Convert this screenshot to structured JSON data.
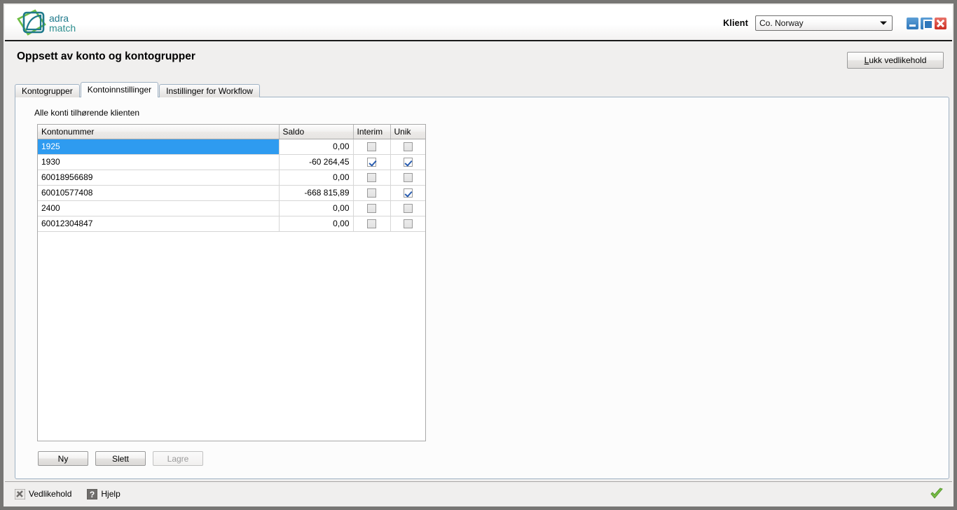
{
  "brand": {
    "logo_name": "adra-match-logo",
    "logo_line1": "adra",
    "logo_line2": "match",
    "teal": "#1f7a8c",
    "green": "#6fbe44"
  },
  "titlebar": {
    "client_label": "Klient",
    "client_value": "Co. Norway",
    "client_options": [
      "Co. Norway"
    ],
    "window_buttons": {
      "minimize": "minimize-icon",
      "maximize": "maximize-icon",
      "close": "close-icon"
    }
  },
  "header": {
    "title": "Oppsett av konto og kontogrupper",
    "close_button_accel": "L",
    "close_button_rest": "ukk vedlikehold",
    "close_button_label": "Lukk vedlikehold"
  },
  "tabs": [
    {
      "label": "Kontogrupper",
      "active": false
    },
    {
      "label": "Kontoinnstillinger",
      "active": true
    },
    {
      "label": "Instillinger for Workflow",
      "active": false
    }
  ],
  "panel": {
    "label": "Alle konti tilhørende klienten"
  },
  "grid": {
    "columns": [
      "Kontonummer",
      "Saldo",
      "Interim",
      "Unik"
    ],
    "selected_row_index": 0,
    "selected_row_color": "#2e9bf0",
    "rows": [
      {
        "kontonummer": "1925",
        "saldo": "0,00",
        "interim": false,
        "unik": false
      },
      {
        "kontonummer": "1930",
        "saldo": "-60 264,45",
        "interim": true,
        "unik": true
      },
      {
        "kontonummer": "60018956689",
        "saldo": "0,00",
        "interim": false,
        "unik": false
      },
      {
        "kontonummer": "60010577408",
        "saldo": "-668 815,89",
        "interim": false,
        "unik": true
      },
      {
        "kontonummer": "2400",
        "saldo": "0,00",
        "interim": false,
        "unik": false
      },
      {
        "kontonummer": "60012304847",
        "saldo": "0,00",
        "interim": false,
        "unik": false
      }
    ]
  },
  "actions": [
    {
      "label": "Ny",
      "disabled": false
    },
    {
      "label": "Slett",
      "disabled": false
    },
    {
      "label": "Lagre",
      "disabled": true
    }
  ],
  "statusbar": {
    "items": [
      {
        "label": "Vedlikehold",
        "icon": "tools-icon"
      },
      {
        "label": "Hjelp",
        "icon": "help-icon"
      }
    ],
    "status_icon": "green-check-icon",
    "status_color": "#77bc45"
  }
}
